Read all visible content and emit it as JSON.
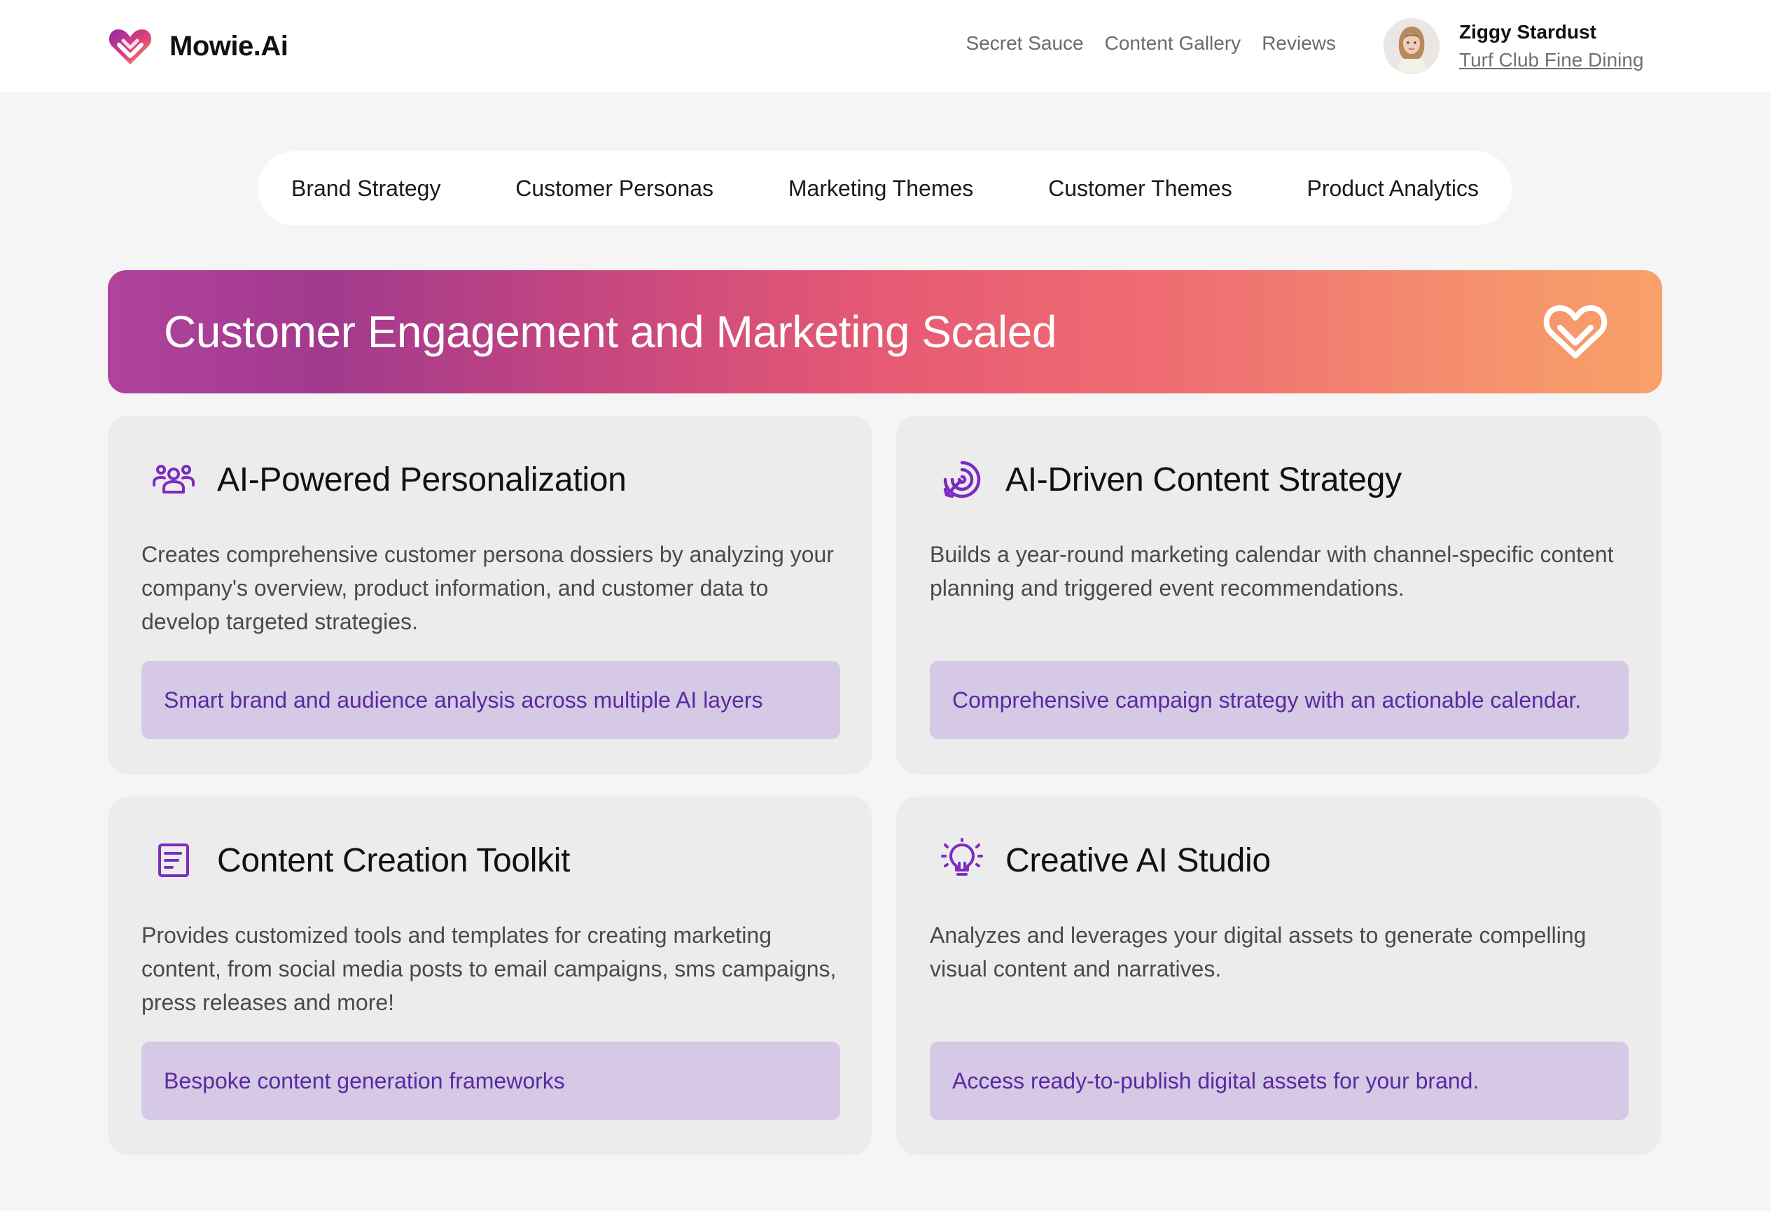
{
  "header": {
    "brand_name": "Mowie.Ai",
    "nav": [
      "Secret Sauce",
      "Content Gallery",
      "Reviews"
    ],
    "user": {
      "name": "Ziggy Stardust",
      "organization": "Turf Club Fine Dining"
    }
  },
  "tabs": [
    "Brand Strategy",
    "Customer Personas",
    "Marketing Themes",
    "Customer Themes",
    "Product Analytics"
  ],
  "hero": {
    "title": "Customer Engagement and Marketing Scaled"
  },
  "cards": [
    {
      "icon": "users-group-icon",
      "title": "AI-Powered Personalization",
      "description": "Creates comprehensive customer persona dossiers by analyzing your company's overview, product information, and customer data to develop targeted strategies.",
      "highlight": "Smart brand and audience analysis across multiple AI layers"
    },
    {
      "icon": "target-arrow-icon",
      "title": "AI-Driven Content Strategy",
      "description": "Builds a year-round marketing calendar with channel-specific content planning and triggered event recommendations.",
      "highlight": "Comprehensive campaign strategy with an actionable calendar."
    },
    {
      "icon": "document-icon",
      "title": "Content Creation Toolkit",
      "description": "Provides customized tools and templates for creating marketing content, from social media posts to email campaigns, sms campaigns, press releases and more!",
      "highlight": "Bespoke content generation frameworks"
    },
    {
      "icon": "lightbulb-icon",
      "title": "Creative AI Studio",
      "description": "Analyzes and leverages your digital assets to generate compelling visual content and narratives.",
      "highlight": "Access ready-to-publish digital assets for your brand."
    }
  ],
  "colors": {
    "accent_purple": "#7b2cbf",
    "pill_background": "#d5c9e6",
    "pill_text": "#5a2aa0",
    "gradient_start": "#b0439c",
    "gradient_end": "#f9a168"
  }
}
